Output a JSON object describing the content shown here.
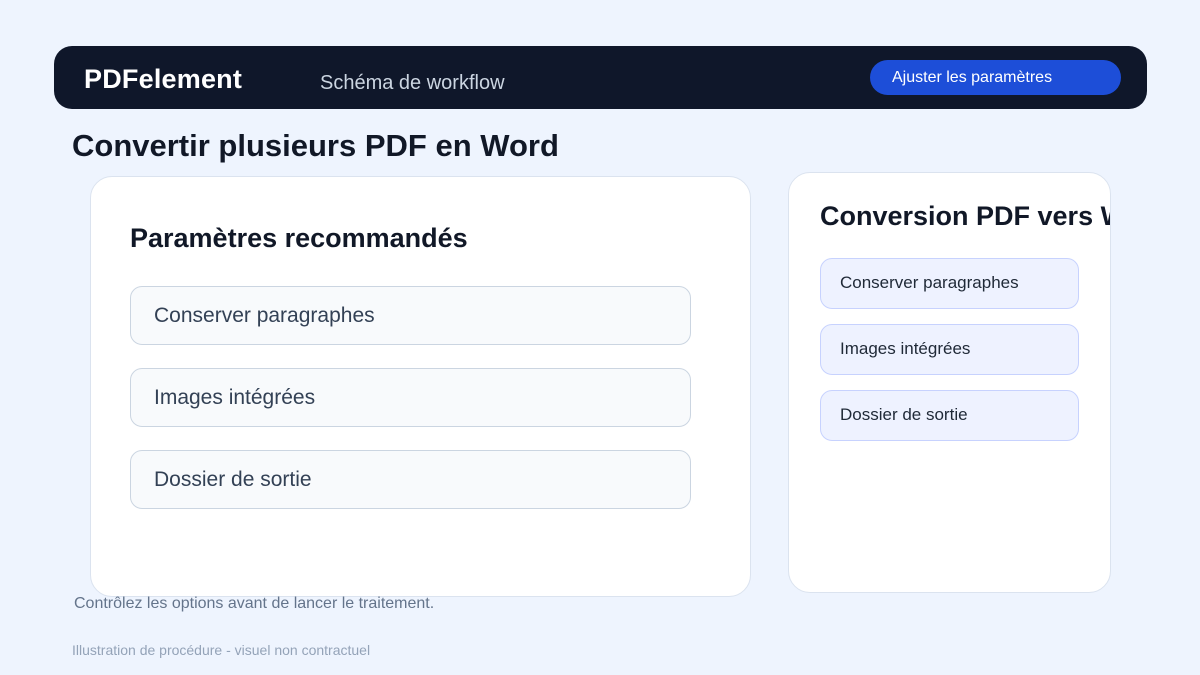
{
  "header": {
    "brand": "PDFelement",
    "subtitle": "Schéma de workflow",
    "adjust_button": "Ajuster les paramètres"
  },
  "page": {
    "title": "Convertir plusieurs PDF en Word",
    "hint": "Contrôlez les options avant de lancer le traitement.",
    "footer": "Illustration de procédure - visuel non contractuel"
  },
  "main_card": {
    "title": "Paramètres recommandés",
    "options": [
      "Conserver paragraphes",
      "Images intégrées",
      "Dossier de sortie"
    ]
  },
  "side_card": {
    "title": "Conversion PDF vers Word par lot",
    "options": [
      "Conserver paragraphes",
      "Images intégrées",
      "Dossier de sortie"
    ]
  },
  "colors": {
    "background": "#eef4fe",
    "header": "#0f172a",
    "accent": "#1d4ed8"
  }
}
